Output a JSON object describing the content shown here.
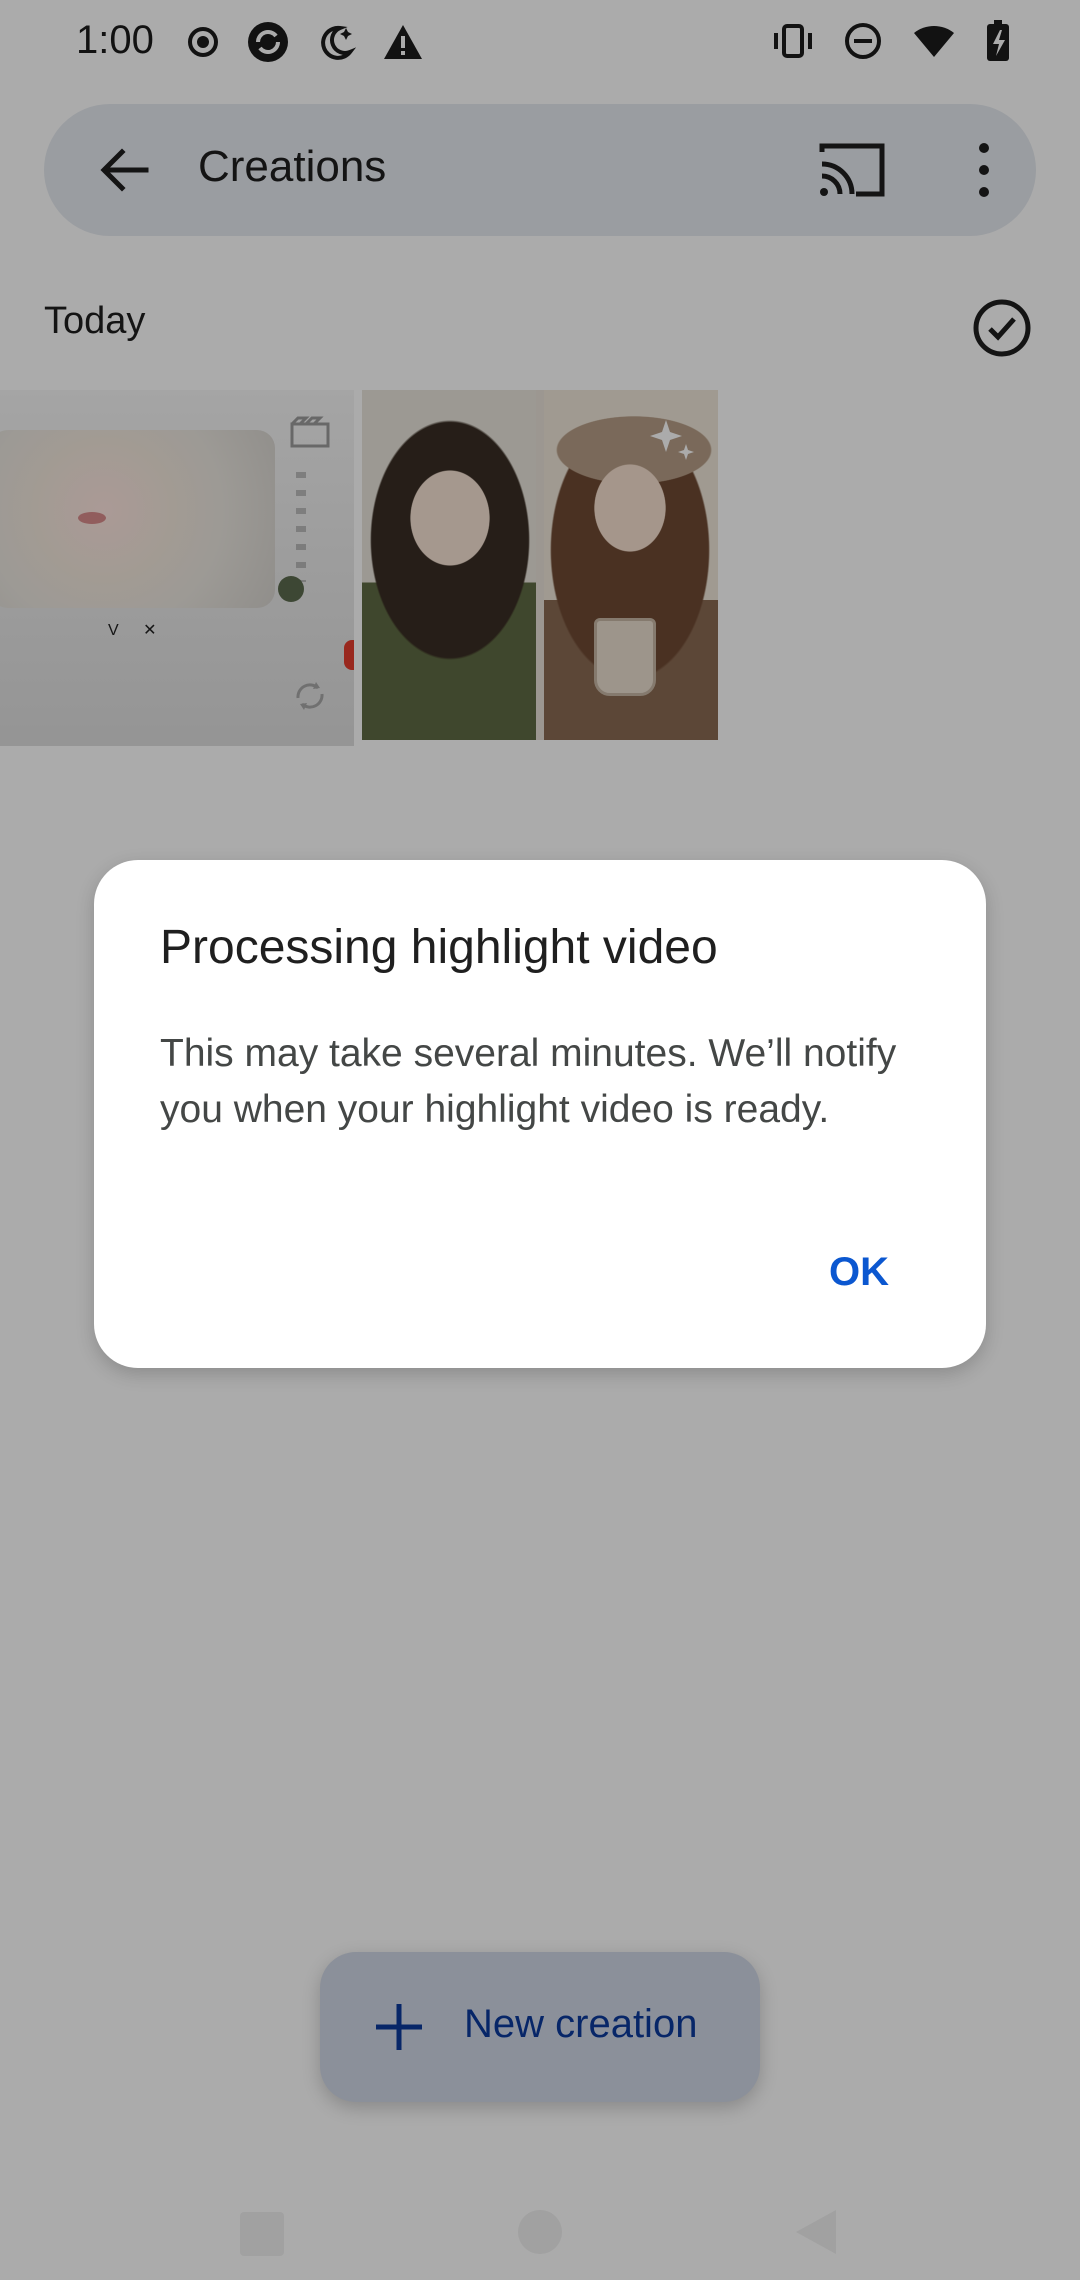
{
  "status_bar": {
    "time": "1:00",
    "left_icons": [
      "record-icon",
      "sync-app-icon",
      "night-mode-icon",
      "warning-icon"
    ],
    "right_icons": [
      "vibrate-icon",
      "do-not-disturb-icon",
      "wifi-icon",
      "battery-charging-icon"
    ]
  },
  "top_bar": {
    "title": "Creations",
    "back_icon": "arrow-back-icon",
    "cast_icon": "cast-icon",
    "more_icon": "more-vert-icon"
  },
  "section": {
    "title": "Today",
    "select_icon": "check-circle-icon"
  },
  "thumbnails": [
    {
      "kind": "video",
      "icon": "movie-icon",
      "secondary_icon": "loop-icon",
      "caption": "V ✕"
    },
    {
      "kind": "collage",
      "icon": "sparkle-icon"
    }
  ],
  "dialog": {
    "title": "Processing highlight video",
    "body": "This may take several minutes. We’ll notify you when your highlight video is ready.",
    "ok_label": "OK"
  },
  "fab": {
    "label": "New creation",
    "icon": "plus-icon"
  },
  "colors": {
    "accent": "#0b57d0",
    "fab_background": "#cfd7e6",
    "topbar_background": "#e6eaf0",
    "scrim": "rgba(0,0,0,0.33)"
  }
}
